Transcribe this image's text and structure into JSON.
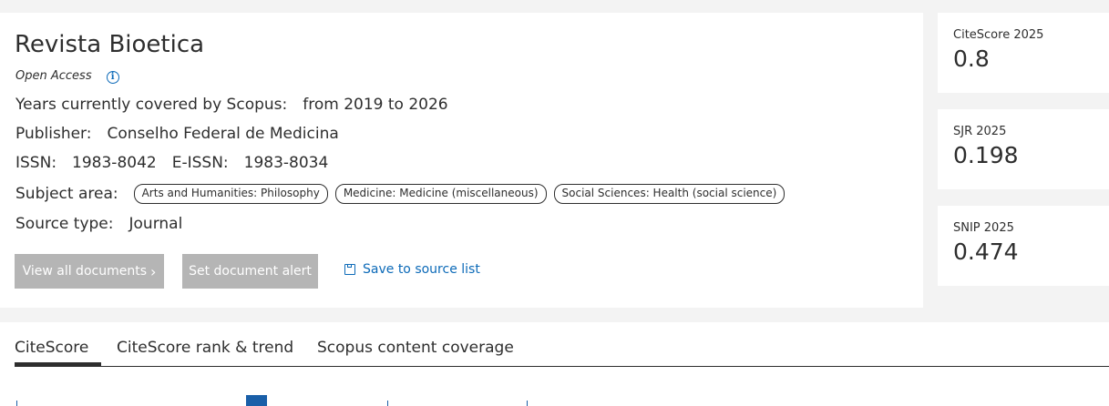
{
  "source": {
    "title": "Revista Bioetica",
    "open_access": "Open Access",
    "years_label": "Years currently covered by Scopus:",
    "years_value": "from 2019 to 2026",
    "publisher_label": "Publisher:",
    "publisher_value": "Conselho Federal de Medicina",
    "issn_label": "ISSN:",
    "issn_value": "1983-8042",
    "eissn_label": "E-ISSN:",
    "eissn_value": "1983-8034",
    "subject_label": "Subject area:",
    "subjects": [
      "Arts and Humanities: Philosophy",
      "Medicine: Medicine (miscellaneous)",
      "Social Sciences: Health (social science)"
    ],
    "type_label": "Source type:",
    "type_value": "Journal"
  },
  "actions": {
    "view_all": "View all documents",
    "set_alert": "Set document alert",
    "save_to_list": "Save to source list"
  },
  "metrics": [
    {
      "label": "CiteScore 2025",
      "value": "0.8"
    },
    {
      "label": "SJR 2025",
      "value": "0.198"
    },
    {
      "label": "SNIP 2025",
      "value": "0.474"
    }
  ],
  "tabs": [
    {
      "label": "CiteScore",
      "active": true
    },
    {
      "label": "CiteScore rank & trend",
      "active": false
    },
    {
      "label": "Scopus content coverage",
      "active": false
    }
  ],
  "colors": {
    "link": "#0c6ab8",
    "disabled_button": "#b5b5b5",
    "text": "#2e2e2e"
  },
  "icons": [
    "info-icon",
    "chevron-right-icon",
    "save-icon"
  ]
}
